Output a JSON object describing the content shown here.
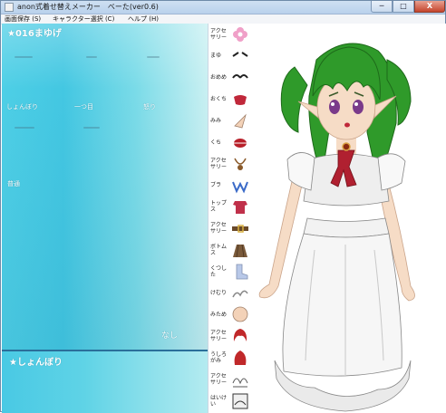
{
  "window": {
    "title": "anon式着せ替えメーカー　べーた(ver0.6)",
    "minimize_label": "─",
    "maximize_label": "□",
    "close_label": "X"
  },
  "menu": {
    "items": [
      {
        "label": "画面保存 (S)"
      },
      {
        "label": "キャラクター選択 (C)"
      },
      {
        "label": "ヘルプ (H)"
      }
    ]
  },
  "panel": {
    "part_title": "★016まゆげ",
    "options": [
      "しょんぼり",
      "一つ目",
      "怒り",
      "普通"
    ],
    "none_label": "なし",
    "selected_title": "★しょんぼり"
  },
  "tabs": [
    {
      "label": "アクセ\nサリー",
      "icon": "flower-icon",
      "color": "#f0a0c8"
    },
    {
      "label": "まゆ",
      "icon": "eyebrow-icon",
      "color": "#222222"
    },
    {
      "label": "おめめ",
      "icon": "eye-icon",
      "color": "#222222"
    },
    {
      "label": "おくち",
      "icon": "mouth-icon",
      "color": "#c0283a"
    },
    {
      "label": "みみ",
      "icon": "ear-icon",
      "color": "#f3d2b8"
    },
    {
      "label": "くち",
      "icon": "lips-icon",
      "color": "#b8202a"
    },
    {
      "label": "アクセ\nサリー",
      "icon": "necklace-icon",
      "color": "#8a5a2a"
    },
    {
      "label": "ブラ",
      "icon": "bra-icon",
      "color": "#3a6ac8"
    },
    {
      "label": "トップス",
      "icon": "top-icon",
      "color": "#c0304a"
    },
    {
      "label": "アクセ\nサリー",
      "icon": "belt-icon",
      "color": "#6a4a2a"
    },
    {
      "label": "ボトムス",
      "icon": "skirt-icon",
      "color": "#7a5a3a"
    },
    {
      "label": "くつした",
      "icon": "socks-icon",
      "color": "#b8c8e8"
    },
    {
      "label": "けむり",
      "icon": "smoke-icon",
      "color": "#888888"
    },
    {
      "label": "みため",
      "icon": "head-icon",
      "color": "#f3d2b8"
    },
    {
      "label": "アクセサリー",
      "icon": "hair-icon",
      "color": "#c0282a"
    },
    {
      "label": "うしろ\nがみ",
      "icon": "back-hair-icon",
      "color": "#c0282a"
    },
    {
      "label": "アクセサリー",
      "icon": "scribble-icon",
      "color": "#555555"
    },
    {
      "label": "はいけい",
      "icon": "background-icon",
      "color": "#333333"
    }
  ],
  "character": {
    "hair_color": "#2f9a2a",
    "eye_color": "#7a3a8a",
    "dress_color": "#f4f4f4",
    "ribbon_color": "#b02030"
  }
}
